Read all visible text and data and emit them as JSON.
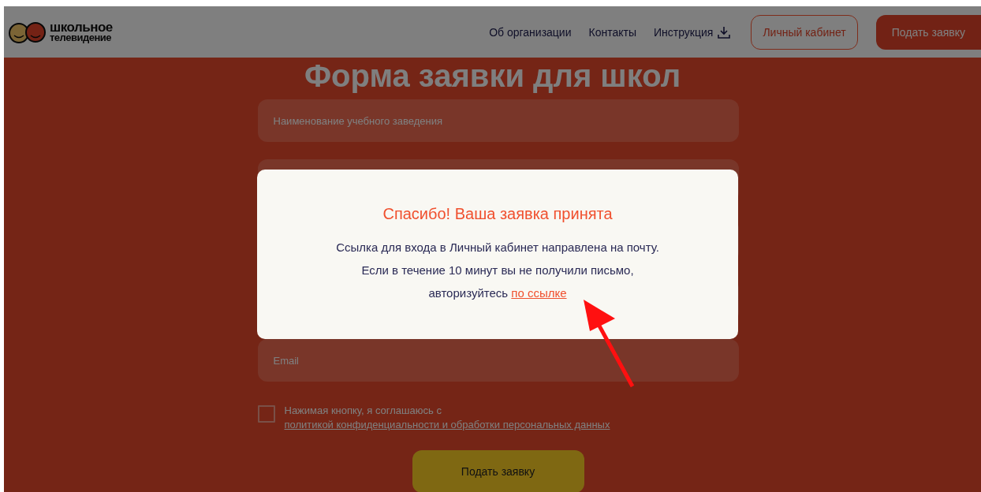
{
  "header": {
    "logo_lines": [
      "школьное",
      "телевидение"
    ],
    "nav": [
      {
        "label": "Об организации",
        "kind": "link"
      },
      {
        "label": "Контакты",
        "kind": "link"
      },
      {
        "label": "Инструкция",
        "kind": "download"
      }
    ],
    "buttons": [
      {
        "label": "Личный кабинет",
        "kind": "outline"
      },
      {
        "label": "Подать заявку",
        "kind": "filled"
      }
    ]
  },
  "form": {
    "title": "Форма заявки для школ",
    "fields": [
      {
        "kind": "text",
        "placeholder": "Наименование учебного заведения"
      },
      {
        "kind": "covered"
      },
      {
        "kind": "covered"
      },
      {
        "kind": "covered"
      },
      {
        "kind": "text",
        "placeholder": "Email"
      }
    ],
    "consent": {
      "checked": false,
      "text": "Нажимая кнопку, я соглашаюсь с ",
      "link": "политикой конфиденциальности и обработки персональных данных"
    },
    "submit": "Подать заявку"
  },
  "modal": {
    "title": "Спасибо! Ваша заявка принята",
    "lines": [
      "Ссылка для входа в Личный кабинет направлена на почту.",
      "Если в течение 10 минут вы не получили письмо,"
    ],
    "last_line": "авторизуйтесь ",
    "link": "по ссылке"
  }
}
